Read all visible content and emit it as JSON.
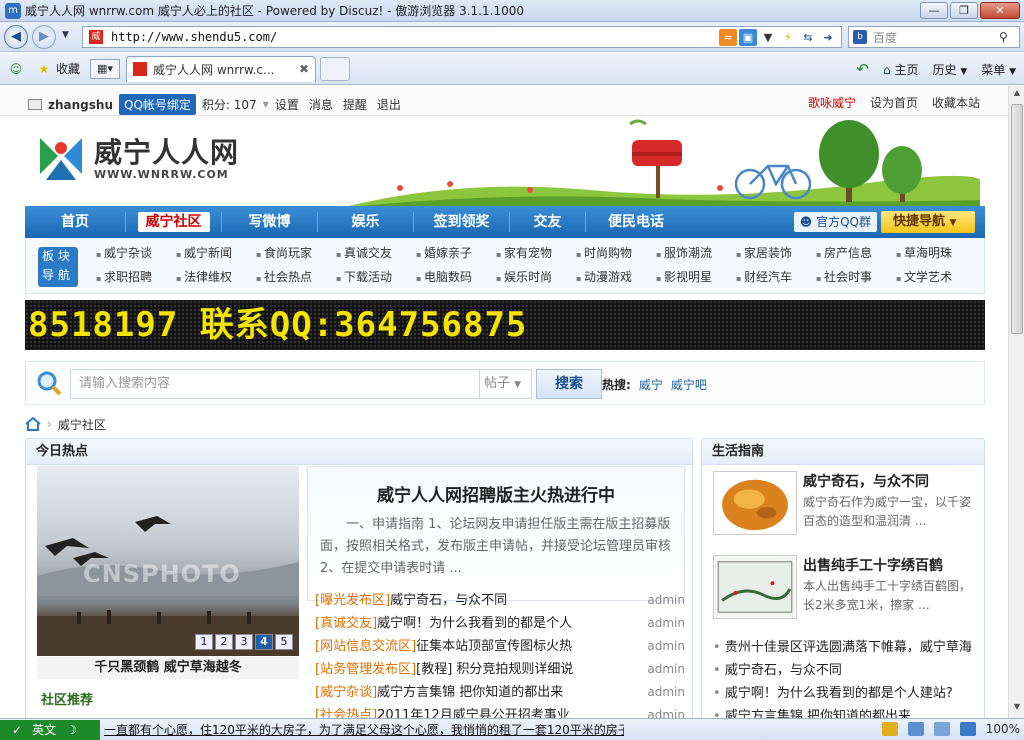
{
  "browser": {
    "title": "威宁人人网 wnrrw.com 威宁人必上的社区 - Powered by Discuz! - 傲游浏览器 3.1.1.1000",
    "url": "http://www.shendu5.com/",
    "search_placeholder": "百度",
    "toolbar": {
      "favorites": "收藏",
      "home": "主页",
      "history": "历史",
      "menu": "菜单"
    },
    "tab_title": "威宁人人网 wnrrw.c...",
    "zoom": "100%"
  },
  "sitebar": {
    "username": "zhangshu",
    "qq_bind": "QQ帐号绑定",
    "points": "积分: 107",
    "links": [
      "设置",
      "消息",
      "提醒",
      "退出"
    ],
    "right": [
      "歌咏威宁",
      "设为首页",
      "收藏本站"
    ]
  },
  "logo": {
    "name": "威宁人人网",
    "domain": "WWW.WNRRW.COM"
  },
  "mainnav": {
    "items": [
      "首页",
      "威宁社区",
      "写微博",
      "娱乐",
      "签到领奖",
      "交友",
      "便民电话"
    ],
    "active": "威宁社区",
    "qq_group": "官方QQ群",
    "quick_nav": "快捷导航"
  },
  "subnav": {
    "tag": "板块导航",
    "items": [
      "威宁杂谈",
      "威宁新闻",
      "食尚玩家",
      "真诚交友",
      "婚嫁亲子",
      "家有宠物",
      "时尚购物",
      "服饰潮流",
      "家居装饰",
      "房产信息",
      "草海明珠",
      "求职招聘",
      "法律维权",
      "社会热点",
      "下载活动",
      "电脑数码",
      "娱乐时尚",
      "动漫游戏",
      "影视明星",
      "财经汽车",
      "社会时事",
      "文学艺术"
    ]
  },
  "led_text": "8518197 联系QQ:364756875",
  "search": {
    "placeholder": "请输入搜索内容",
    "scope": "帖子",
    "button": "搜索",
    "hot_label": "热搜:",
    "hot": [
      "威宁",
      "威宁吧"
    ]
  },
  "breadcrumb": "威宁社区",
  "hot_today": {
    "title": "今日热点",
    "photo_watermark": "CNSPHOTO",
    "slides": [
      "1",
      "2",
      "3",
      "4",
      "5"
    ],
    "active_slide": "4",
    "photo_caption": "千只黑颈鹤  威宁草海越冬",
    "community_title": "社区推荐",
    "featured": {
      "title": "威宁人人网招聘版主火热进行中",
      "summary": "一、申请指南 1、论坛网友申请担任版主需在版主招募版面，按照相关格式，发布版主申请帖，并接受论坛管理员审核 2、在提交申请表时请 ..."
    },
    "threads": [
      {
        "cat": "[曝光发布区]",
        "title": "威宁奇石，与众不同",
        "author": "admin"
      },
      {
        "cat": "[真诚交友]",
        "title": "威宁啊！为什么我看到的都是个人",
        "author": "admin"
      },
      {
        "cat": "[网站信息交流区]",
        "title": "征集本站顶部宣传图标火热",
        "author": "admin"
      },
      {
        "cat": "[站务管理发布区]",
        "title": "[教程] 积分竞拍规则详细说",
        "author": "admin"
      },
      {
        "cat": "[威宁杂谈]",
        "title": "威宁方言集锦 把你知道的都出来",
        "author": "admin"
      },
      {
        "cat": "[社会热点]",
        "title": "2011年12月威宁县公开招考事业",
        "author": "admin"
      }
    ]
  },
  "life": {
    "title": "生活指南",
    "items": [
      {
        "title": "威宁奇石，与众不同",
        "desc": "威宁奇石作为威宁一宝，以千姿百态的造型和温润清 ..."
      },
      {
        "title": "出售纯手工十字绣百鹤",
        "desc": "本人出售纯手工十字绣百鹤图，长2米多宽1米，擦家 ..."
      }
    ],
    "links": [
      "贵州十佳景区评选圆满落下帷幕，威宁草海",
      "威宁奇石，与众不同",
      "威宁啊！为什么我看到的都是个人建站?",
      "威宁方言集锦 把你知道的都出来"
    ]
  },
  "statusbar": {
    "ime": "英文",
    "text": "一直都有个心愿，住120平米的大房子，为了满足父母这个心愿，我悄悄的租了一套120平米的房子"
  }
}
